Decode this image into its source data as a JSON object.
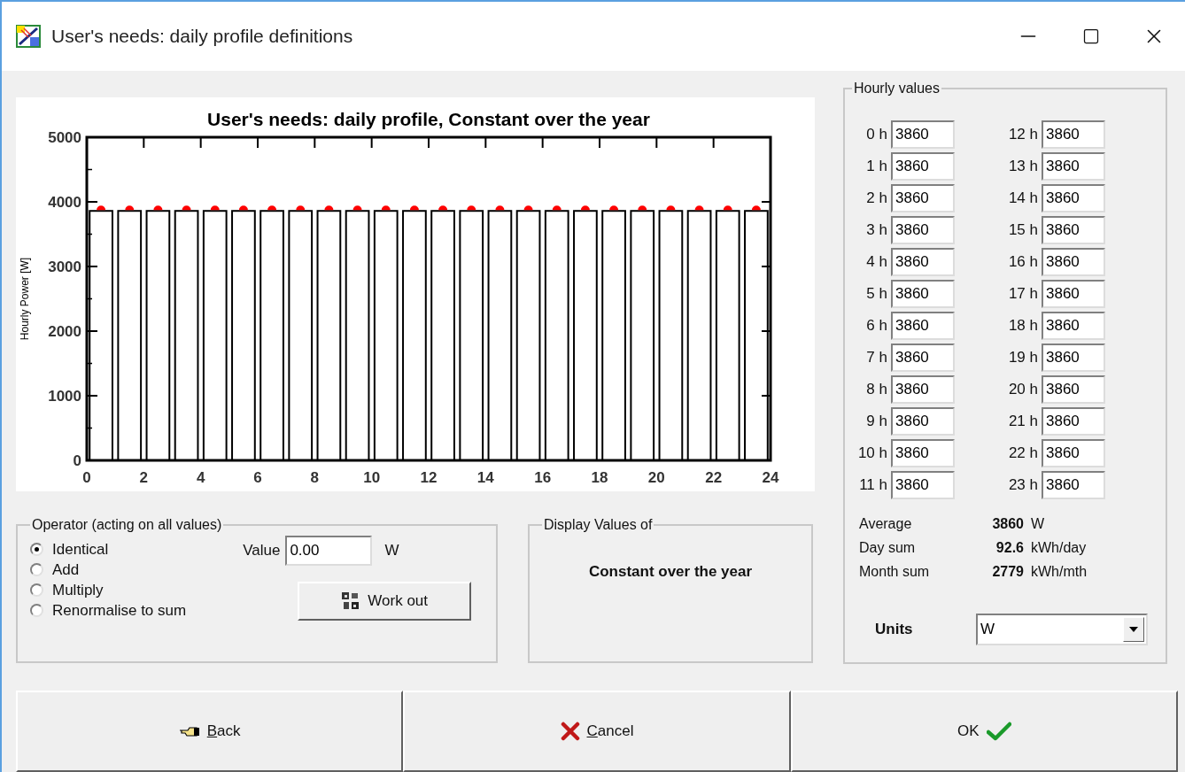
{
  "window": {
    "title": "User's needs: daily profile definitions"
  },
  "chart": {
    "chart_data": {
      "type": "bar",
      "title": "User's needs: daily profile, Constant over the year",
      "ylabel": "Hourly Power [W]",
      "x": [
        0.5,
        1.5,
        2.5,
        3.5,
        4.5,
        5.5,
        6.5,
        7.5,
        8.5,
        9.5,
        10.5,
        11.5,
        12.5,
        13.5,
        14.5,
        15.5,
        16.5,
        17.5,
        18.5,
        19.5,
        20.5,
        21.5,
        22.5,
        23.5
      ],
      "values": [
        3860,
        3860,
        3860,
        3860,
        3860,
        3860,
        3860,
        3860,
        3860,
        3860,
        3860,
        3860,
        3860,
        3860,
        3860,
        3860,
        3860,
        3860,
        3860,
        3860,
        3860,
        3860,
        3860,
        3860
      ],
      "xlim": [
        0,
        24
      ],
      "ylim": [
        0,
        5000
      ],
      "xticks": [
        0,
        2,
        4,
        6,
        8,
        10,
        12,
        14,
        16,
        18,
        20,
        22,
        24
      ],
      "yticks": [
        0,
        1000,
        2000,
        3000,
        4000,
        5000
      ]
    }
  },
  "operator": {
    "title": "Operator  (acting on all values)",
    "options": [
      {
        "label": "Identical",
        "selected": true
      },
      {
        "label": "Add",
        "selected": false
      },
      {
        "label": "Multiply",
        "selected": false
      },
      {
        "label": "Renormalise to sum",
        "selected": false
      }
    ],
    "value_label": "Value",
    "value": "0.00",
    "value_unit": "W",
    "work_out_button": "Work out"
  },
  "display_values": {
    "title": "Display Values of",
    "value": "Constant over the year"
  },
  "hourly_values": {
    "title": "Hourly values",
    "hours": [
      {
        "label": "0 h",
        "value": "3860"
      },
      {
        "label": "1 h",
        "value": "3860"
      },
      {
        "label": "2 h",
        "value": "3860"
      },
      {
        "label": "3 h",
        "value": "3860"
      },
      {
        "label": "4 h",
        "value": "3860"
      },
      {
        "label": "5 h",
        "value": "3860"
      },
      {
        "label": "6 h",
        "value": "3860"
      },
      {
        "label": "7 h",
        "value": "3860"
      },
      {
        "label": "8 h",
        "value": "3860"
      },
      {
        "label": "9 h",
        "value": "3860"
      },
      {
        "label": "10 h",
        "value": "3860"
      },
      {
        "label": "11 h",
        "value": "3860"
      },
      {
        "label": "12 h",
        "value": "3860"
      },
      {
        "label": "13 h",
        "value": "3860"
      },
      {
        "label": "14 h",
        "value": "3860"
      },
      {
        "label": "15 h",
        "value": "3860"
      },
      {
        "label": "16 h",
        "value": "3860"
      },
      {
        "label": "17 h",
        "value": "3860"
      },
      {
        "label": "18 h",
        "value": "3860"
      },
      {
        "label": "19 h",
        "value": "3860"
      },
      {
        "label": "20 h",
        "value": "3860"
      },
      {
        "label": "21 h",
        "value": "3860"
      },
      {
        "label": "22 h",
        "value": "3860"
      },
      {
        "label": "23 h",
        "value": "3860"
      }
    ],
    "stats": [
      {
        "label": "Average",
        "value": "3860",
        "unit": "W"
      },
      {
        "label": "Day sum",
        "value": "92.6",
        "unit": "kWh/day"
      },
      {
        "label": "Month sum",
        "value": "2779",
        "unit": "kWh/mth"
      }
    ],
    "units_label": "Units",
    "units_value": "W"
  },
  "buttons": [
    {
      "kind": "back",
      "label": "Back"
    },
    {
      "kind": "cancel",
      "label": "Cancel"
    },
    {
      "kind": "ok",
      "label": "OK"
    }
  ]
}
